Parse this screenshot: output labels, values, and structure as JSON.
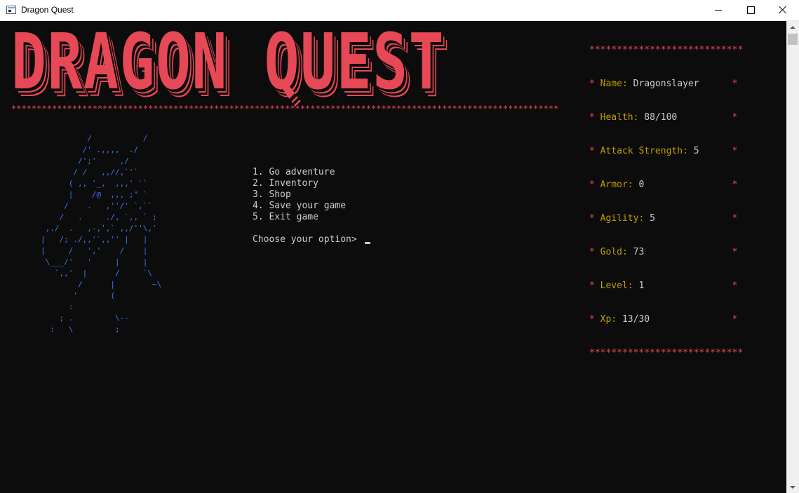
{
  "window": {
    "title": "Dragon Quest",
    "app_icon": "console-icon",
    "controls": {
      "minimize": "minimize-icon",
      "maximize": "maximize-icon",
      "close": "close-icon"
    }
  },
  "banner": {
    "text": "DRAGON QUEST",
    "stars": "********************************************************************************************************************************************",
    "color": "#e74856"
  },
  "stats": {
    "border": "****************************",
    "rows": [
      {
        "label": "Name:",
        "value": "Dragonslayer",
        "pad": "      "
      },
      {
        "label": "Health:",
        "value": "88/100",
        "pad": "          "
      },
      {
        "label": "Attack Strength:",
        "value": "5",
        "pad": "      "
      },
      {
        "label": "Armor:",
        "value": "0",
        "pad": "                "
      },
      {
        "label": "Agility:",
        "value": "5",
        "pad": "              "
      },
      {
        "label": "Gold:",
        "value": "73",
        "pad": "                "
      },
      {
        "label": "Level:",
        "value": "1",
        "pad": "                "
      },
      {
        "label": "Xp:",
        "value": "13/30",
        "pad": "               "
      }
    ],
    "label_color": "#c19c00",
    "border_color": "#e74856"
  },
  "dragon_art": "          /           /\n         /' .,,,,  ./\n        /';'     ,/\n       / /   ,,//,`'`\n      ( ,, '_,  ,,,' ``\n      |    /@  ,,, ;\" `\n     /    .   ,''/' `,``\n    /   .     ./, `,, ` ;\n ,./  .   ,-,',` ,,/''\\,'\n|   /; ./,,'`,,'' |   |\n|     /   ','    /    |\n \\___/'   '     |     |\n   `,,'  |      /     `\\\n        /      |        ~\\\n       '       (\n      :\n    ; .         \\--\n  :   \\         ;",
  "menu": {
    "items": [
      "1. Go adventure",
      "2. Inventory",
      "3. Shop",
      "4. Save your game",
      "5. Exit game"
    ],
    "prompt": "Choose your option> "
  },
  "colors": {
    "background": "#0c0c0c",
    "text": "#cccccc",
    "red": "#e74856",
    "gold": "#c19c00",
    "blue": "#3b78ff"
  }
}
